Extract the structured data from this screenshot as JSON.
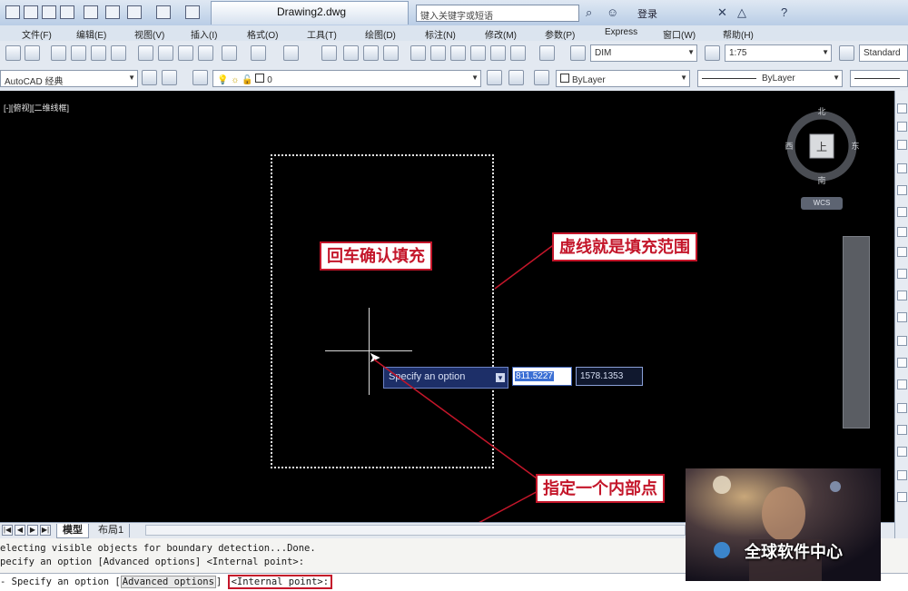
{
  "window": {
    "document_title": "Drawing2.dwg",
    "search_placeholder": "键入关键字或短语",
    "login_label": "登录"
  },
  "menu": {
    "items": [
      "文件(F)",
      "编辑(E)",
      "视图(V)",
      "插入(I)",
      "格式(O)",
      "工具(T)",
      "绘图(D)",
      "标注(N)",
      "修改(M)",
      "参数(P)",
      "Express",
      "窗口(W)",
      "帮助(H)"
    ]
  },
  "toolbar1": {
    "dim_style": "DIM",
    "scale": "1:75",
    "text_style": "Standard"
  },
  "toolbar2": {
    "workspace": "AutoCAD 经典",
    "layer": "0",
    "color": "ByLayer",
    "linetype": "ByLayer"
  },
  "canvas": {
    "view_label": "[-][俯视][二维线框]",
    "prompt_label": "Specify an option",
    "prompt_btn": "▾",
    "coord_x": "811.5227",
    "coord_y": "1578.1353"
  },
  "annotations": {
    "enter_confirm": "回车确认填充",
    "dashed_range": "虚线就是填充范围",
    "internal_point": "指定一个内部点"
  },
  "viewcube": {
    "north": "北",
    "south": "南",
    "east": "东",
    "west": "西",
    "top": "上",
    "wcs": "WCS"
  },
  "layout_tabs": [
    "模型",
    "布局1"
  ],
  "command": {
    "line1": "electing visible objects for boundary detection...Done.",
    "line2": "pecify an option [Advanced options] <Internal point>:",
    "prompt_prefix": "-  Specify an option [",
    "advanced": "Advanced options",
    "prompt_mid": "] ",
    "internal": "<Internal point>:"
  },
  "watermark": {
    "text": "全球软件中心"
  },
  "colors": {
    "annotation_red": "#c4162a",
    "canvas_bg": "#000000",
    "prompt_bg": "#1d2f68"
  }
}
